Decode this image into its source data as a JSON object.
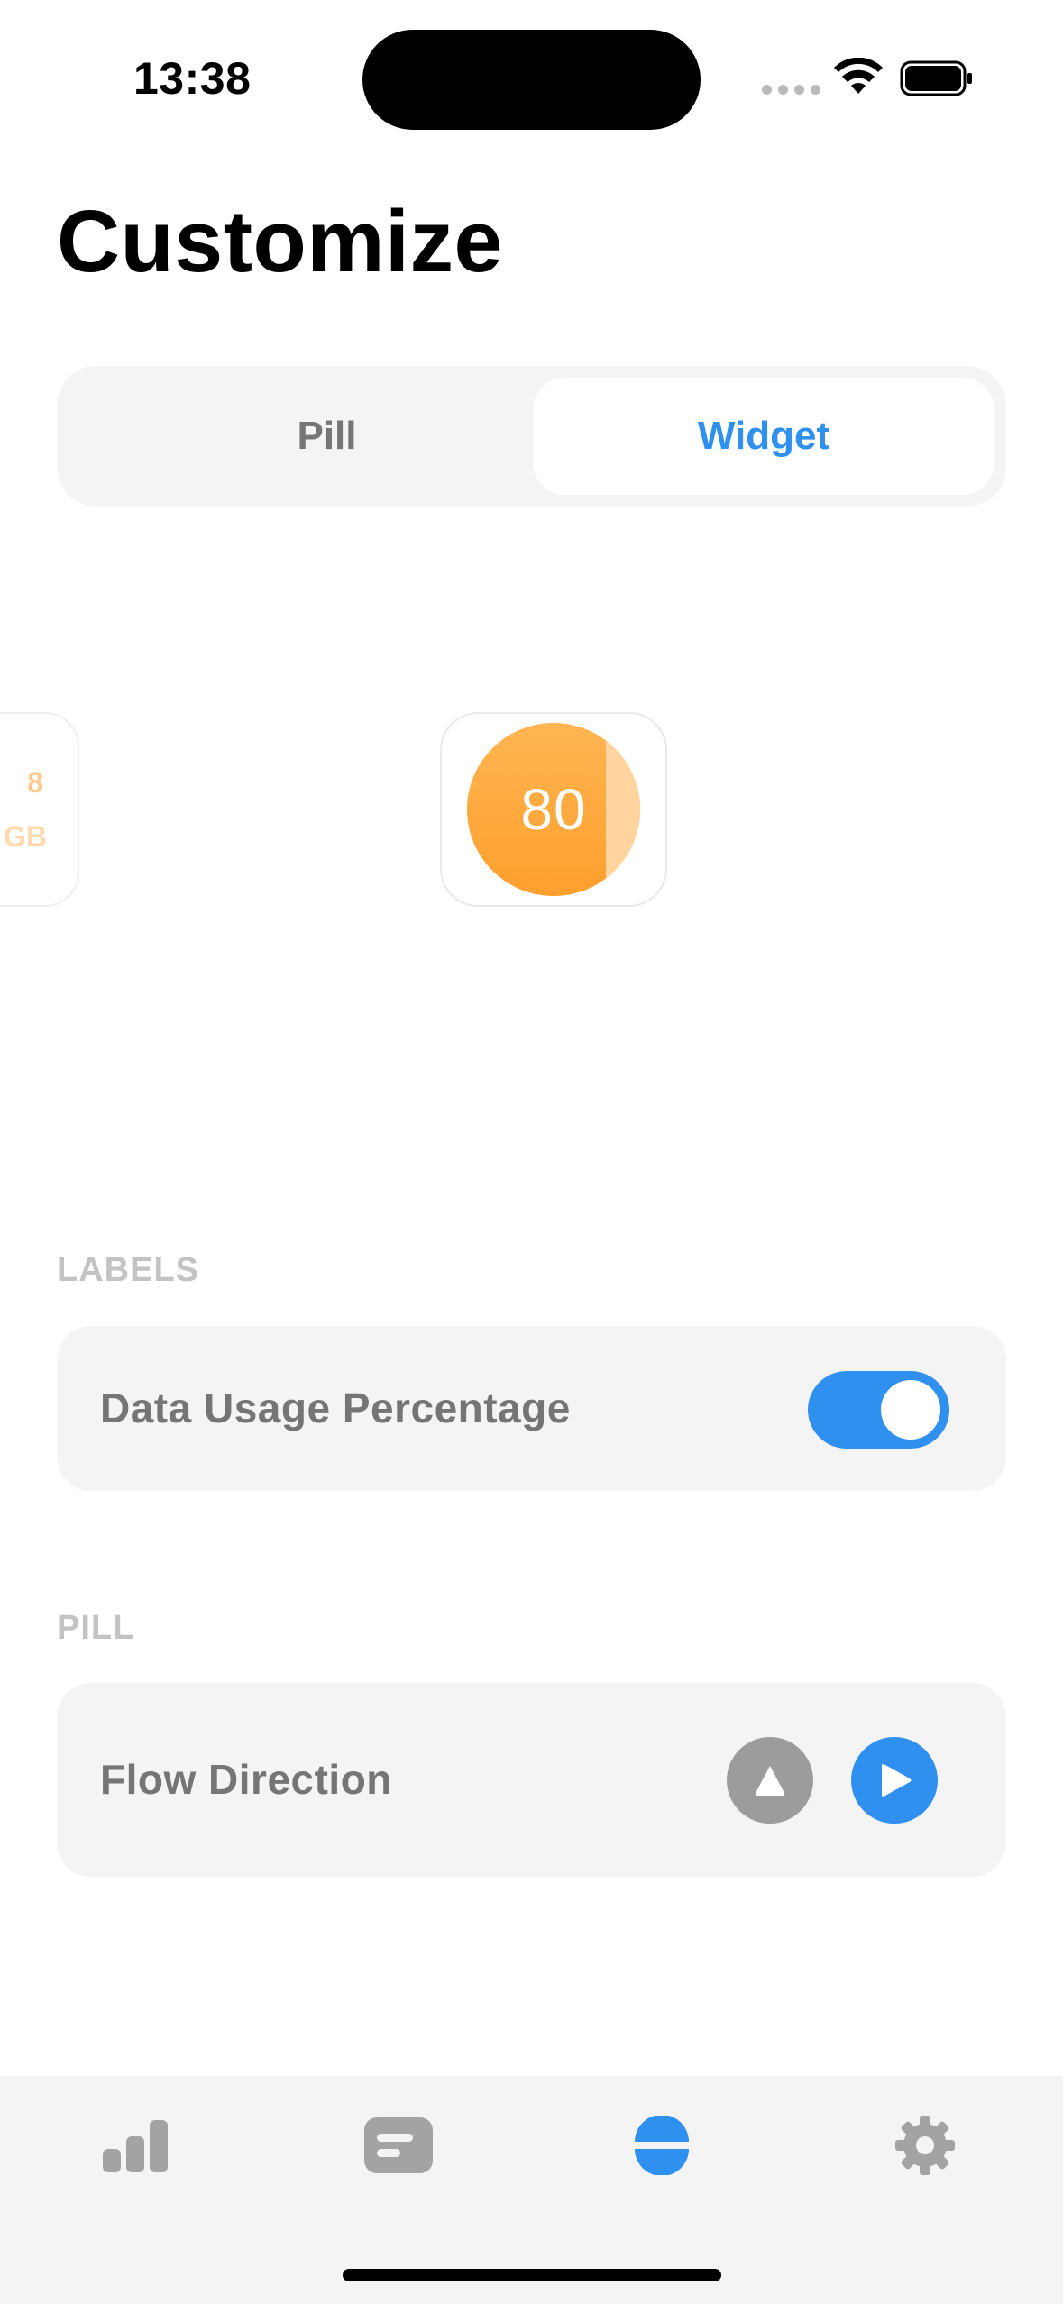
{
  "status_bar": {
    "time": "13:38"
  },
  "page": {
    "title": "Customize"
  },
  "segmented_control": {
    "options": [
      "Pill",
      "Widget"
    ],
    "selected": "Widget"
  },
  "widget_preview": {
    "side_card": {
      "value": "8",
      "unit": "GB"
    },
    "gauge": {
      "value": "80",
      "fill_percent": 80,
      "fill_color": "#ffa43a",
      "empty_color": "#ffd49e"
    }
  },
  "labels_section": {
    "header": "LABELS",
    "data_usage_percentage": {
      "label": "Data Usage Percentage",
      "enabled": true
    }
  },
  "pill_section": {
    "header": "PILL",
    "flow_direction": {
      "label": "Flow Direction",
      "options": [
        "up",
        "right"
      ],
      "selected": "right"
    }
  },
  "tab_bar": {
    "items": [
      {
        "icon": "bar-chart-icon"
      },
      {
        "icon": "widget-icon"
      },
      {
        "icon": "pill-icon",
        "active": true
      },
      {
        "icon": "gear-icon"
      }
    ]
  },
  "colors": {
    "accent": "#2f90f0",
    "inactive": "#9c9c9c",
    "card_background": "#f4f4f4",
    "section_header": "#c3c3c3"
  }
}
